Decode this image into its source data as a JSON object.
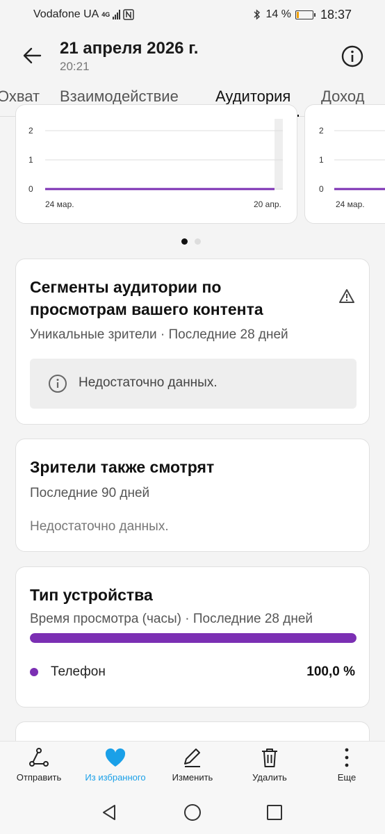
{
  "status_bar": {
    "carrier": "Vodafone UA",
    "network": "4G",
    "battery_percent": "14 %",
    "battery_level": 0.14,
    "time": "18:37"
  },
  "header": {
    "title": "21 апреля 2026 г.",
    "subtitle": "20:21",
    "back_icon": "arrow-left-icon",
    "info_icon": "info-icon"
  },
  "tabs": [
    {
      "label": "Охват",
      "active": false
    },
    {
      "label": "Взаимодействие",
      "active": false
    },
    {
      "label": "Аудитория",
      "active": true
    },
    {
      "label": "Доход",
      "active": false
    }
  ],
  "charts": [
    {
      "y_ticks": [
        "2",
        "1",
        "0"
      ],
      "x_labels": [
        "24 мар.",
        "20 апр."
      ],
      "line_color": "#7b2fb3"
    },
    {
      "y_ticks": [
        "2",
        "1",
        "0"
      ],
      "x_labels": [
        "24 мар."
      ],
      "line_color": "#7b2fb3"
    }
  ],
  "carousel": {
    "pages": 2,
    "current": 1
  },
  "segments_card": {
    "title_line1": "Сегменты аудитории по",
    "title_line2": "просмотрам вашего контента",
    "subtitle": "Уникальные зрители · Последние 28 дней",
    "message": "Недостаточно данных.",
    "warning_icon": "warning-icon"
  },
  "also_watch_card": {
    "title": "Зрители также смотрят",
    "subtitle": "Последние 90 дней",
    "message": "Недостаточно данных."
  },
  "device_card": {
    "title": "Тип устройства",
    "subtitle": "Время просмотра (часы) · Последние 28 дней",
    "bar_fraction": 1.0,
    "bar_color": "#7b2fb3",
    "legend_label": "Телефон",
    "legend_value": "100,0 %"
  },
  "action_bar": [
    {
      "label": "Отправить",
      "icon": "share-icon"
    },
    {
      "label": "Из избранного",
      "icon": "heart-icon",
      "active": true
    },
    {
      "label": "Изменить",
      "icon": "edit-icon"
    },
    {
      "label": "Удалить",
      "icon": "trash-icon"
    },
    {
      "label": "Еще",
      "icon": "more-vertical-icon"
    }
  ],
  "nav_bar": {
    "back": "nav-back-icon",
    "home": "nav-home-icon",
    "recents": "nav-recents-icon"
  },
  "colors": {
    "accent": "#7b2fb3",
    "active_action": "#1aa0e8"
  }
}
